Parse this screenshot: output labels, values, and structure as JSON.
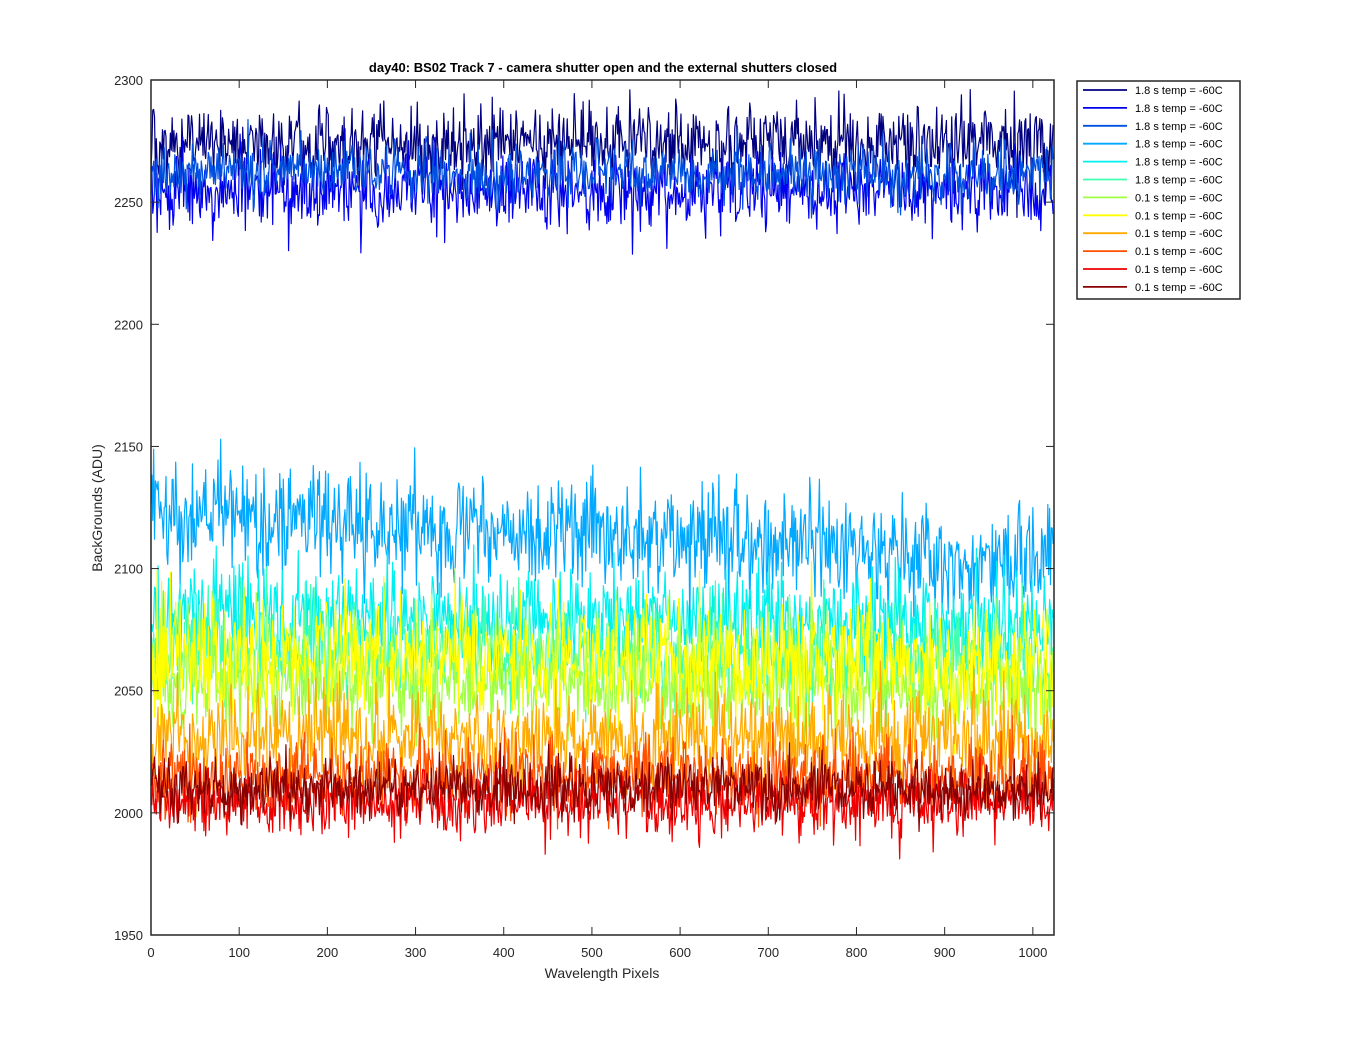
{
  "chart_data": {
    "type": "line",
    "title": "day40: BS02  Track 7 - camera shutter open and the external shutters closed",
    "xlabel": "Wavelength Pixels",
    "ylabel": "BackGrounds (ADU)",
    "xlim": [
      0,
      1024
    ],
    "ylim": [
      1950,
      2300
    ],
    "xticks": [
      "0",
      "100",
      "200",
      "300",
      "400",
      "500",
      "600",
      "700",
      "800",
      "900",
      "1000"
    ],
    "yticks": [
      "1950",
      "2000",
      "2050",
      "2100",
      "2150",
      "2200",
      "2250",
      "2300"
    ],
    "grid": false,
    "legend_position": "outside-top-right",
    "x_points": 1024,
    "series": [
      {
        "name": "1.8 s temp = -60C",
        "color": "#000080",
        "mean": 2274,
        "spread": 8,
        "slope": 0
      },
      {
        "name": "1.8 s temp = -60C",
        "color": "#0000ee",
        "mean": 2255,
        "spread": 8,
        "slope": 0
      },
      {
        "name": "1.8 s temp = -60C",
        "color": "#0050e0",
        "mean": 2262,
        "spread": 6,
        "slope": 0
      },
      {
        "name": "1.8 s temp = -60C",
        "color": "#00a8ff",
        "mean": 2113,
        "spread": 11,
        "slope": -20
      },
      {
        "name": "1.8 s temp = -60C",
        "color": "#00f0f0",
        "mean": 2080,
        "spread": 10,
        "slope": -5
      },
      {
        "name": "1.8 s temp = -60C",
        "color": "#40ffb0",
        "mean": 2066,
        "spread": 10,
        "slope": -5
      },
      {
        "name": "0.1 s temp = -60C",
        "color": "#a0ff40",
        "mean": 2052,
        "spread": 10,
        "slope": -4
      },
      {
        "name": "0.1 s temp = -60C",
        "color": "#ffff00",
        "mean": 2063,
        "spread": 12,
        "slope": -4
      },
      {
        "name": "0.1 s temp = -60C",
        "color": "#ffaa00",
        "mean": 2030,
        "spread": 10,
        "slope": -2
      },
      {
        "name": "0.1 s temp = -60C",
        "color": "#ff5000",
        "mean": 2015,
        "spread": 8,
        "slope": 0
      },
      {
        "name": "0.1 s temp = -60C",
        "color": "#ee0000",
        "mean": 2004,
        "spread": 7,
        "slope": 0
      },
      {
        "name": "0.1 s temp = -60C",
        "color": "#880000",
        "mean": 2010,
        "spread": 6,
        "slope": 0
      }
    ]
  }
}
